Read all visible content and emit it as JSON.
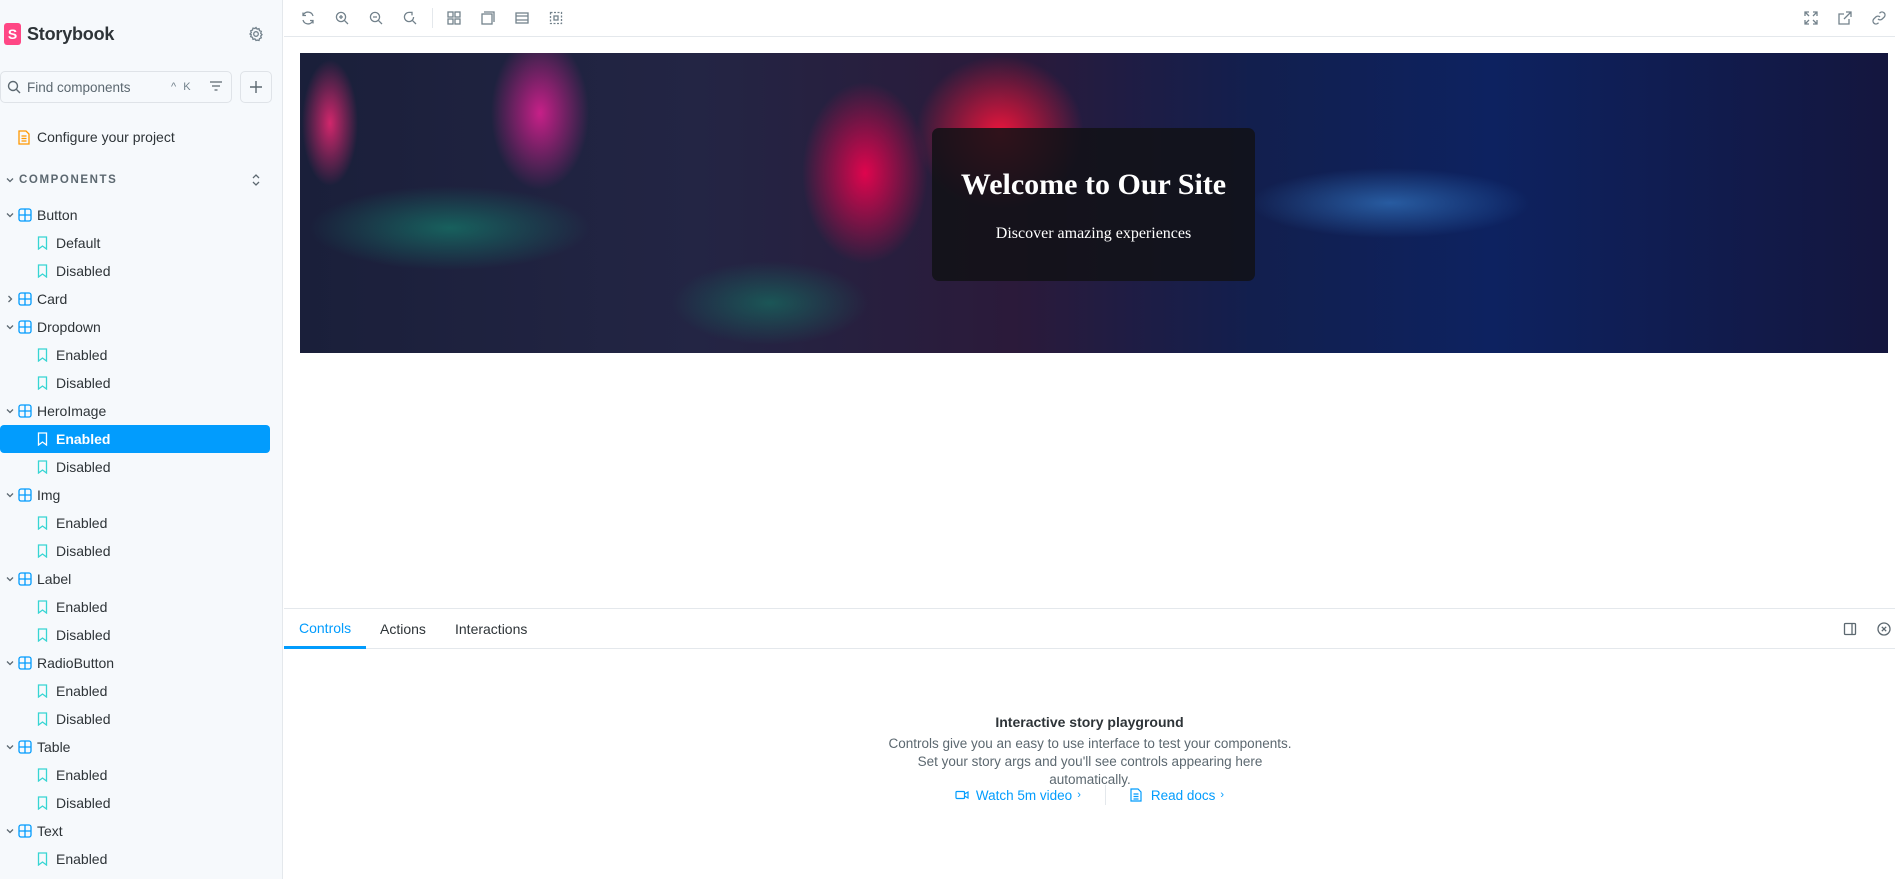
{
  "sidebar": {
    "brand": "Storybook",
    "search_placeholder": "Find components",
    "search_shortcut": "^ K",
    "configure_label": "Configure your project",
    "section_title": "COMPONENTS",
    "tree": [
      {
        "type": "component",
        "label": "Button",
        "expanded": true
      },
      {
        "type": "story",
        "label": "Default"
      },
      {
        "type": "story",
        "label": "Disabled"
      },
      {
        "type": "component",
        "label": "Card",
        "expanded": false
      },
      {
        "type": "component",
        "label": "Dropdown",
        "expanded": true
      },
      {
        "type": "story",
        "label": "Enabled"
      },
      {
        "type": "story",
        "label": "Disabled"
      },
      {
        "type": "component",
        "label": "HeroImage",
        "expanded": true
      },
      {
        "type": "story",
        "label": "Enabled",
        "selected": true
      },
      {
        "type": "story",
        "label": "Disabled"
      },
      {
        "type": "component",
        "label": "Img",
        "expanded": true
      },
      {
        "type": "story",
        "label": "Enabled"
      },
      {
        "type": "story",
        "label": "Disabled"
      },
      {
        "type": "component",
        "label": "Label",
        "expanded": true
      },
      {
        "type": "story",
        "label": "Enabled"
      },
      {
        "type": "story",
        "label": "Disabled"
      },
      {
        "type": "component",
        "label": "RadioButton",
        "expanded": true
      },
      {
        "type": "story",
        "label": "Enabled"
      },
      {
        "type": "story",
        "label": "Disabled"
      },
      {
        "type": "component",
        "label": "Table",
        "expanded": true
      },
      {
        "type": "story",
        "label": "Enabled"
      },
      {
        "type": "story",
        "label": "Disabled"
      },
      {
        "type": "component",
        "label": "Text",
        "expanded": true
      },
      {
        "type": "story",
        "label": "Enabled"
      }
    ]
  },
  "toolbar": {
    "left_icons": [
      "reload-icon",
      "zoom-in-icon",
      "zoom-out-icon",
      "zoom-reset-icon",
      "grid-icon",
      "background-icon",
      "viewport-icon",
      "outline-icon"
    ],
    "right_icons": [
      "fullscreen-icon",
      "open-new-tab-icon",
      "copy-link-icon"
    ]
  },
  "hero": {
    "title": "Welcome to Our Site",
    "subtitle": "Discover amazing experiences"
  },
  "panel": {
    "tabs": [
      {
        "label": "Controls",
        "active": true
      },
      {
        "label": "Actions"
      },
      {
        "label": "Interactions"
      }
    ],
    "empty_title": "Interactive story playground",
    "empty_description": "Controls give you an easy to use interface to test your components. Set your story args and you'll see controls appearing here automatically.",
    "video_link": "Watch 5m video",
    "docs_link": "Read docs"
  },
  "colors": {
    "accent": "#029cfd",
    "brand": "#ff4785",
    "component_icon": "#029cfd",
    "story_icon": "#37d5d3",
    "configure_icon": "#ff9800"
  }
}
